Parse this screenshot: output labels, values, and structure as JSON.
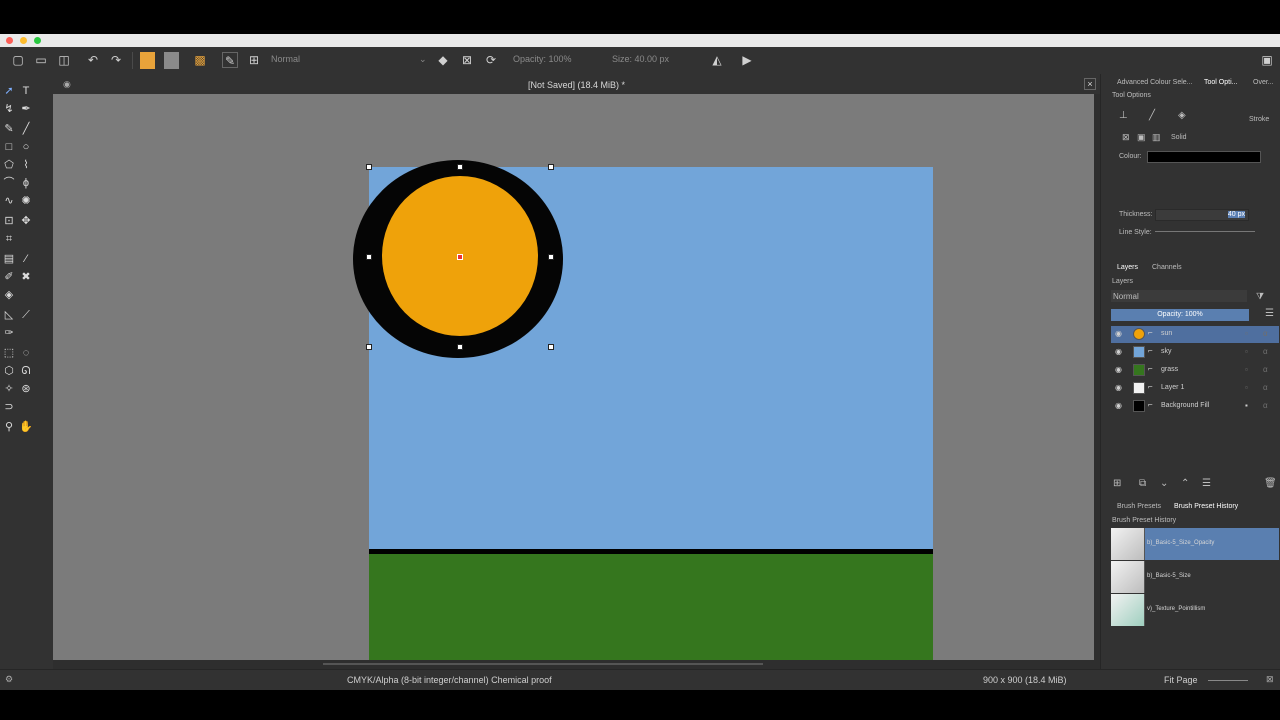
{
  "toolbar": {
    "blend_mode": "Normal",
    "opacity": "Opacity: 100%",
    "size": "Size: 40.00 px",
    "colors": {
      "foreground": "#e8a33a",
      "background": "#8a8a8a"
    }
  },
  "document": {
    "tab_title": "[Not Saved]  (18.4 MiB) *",
    "colors": {
      "sky": "#72a5d9",
      "grass": "#35761e",
      "sun_fill": "#efa20a",
      "sun_outline": "#050505",
      "horizon_line": "#000000"
    }
  },
  "right_dock": {
    "tabs": [
      "Advanced Colour Sele...",
      "Tool Opti...",
      "Over..."
    ],
    "tool_options": {
      "title": "Tool Options",
      "stroke_label": "Stroke",
      "solid_label": "Solid",
      "colour_label": "Colour:",
      "colour_value": "#000000",
      "thickness_label": "Thickness:",
      "thickness_value": "40 px",
      "line_style_label": "Line Style:"
    },
    "layers_panel": {
      "tabs": [
        "Layers",
        "Channels"
      ],
      "title": "Layers",
      "blend_mode": "Normal",
      "opacity": "Opacity:  100%",
      "layers": [
        {
          "name": "sun",
          "thumb": "#efa20a",
          "selected": true
        },
        {
          "name": "sky",
          "thumb": "#72a5d9",
          "selected": false
        },
        {
          "name": "grass",
          "thumb": "#35761e",
          "selected": false
        },
        {
          "name": "Layer 1",
          "thumb": "#f2f2f2",
          "selected": false
        },
        {
          "name": "Background Fill",
          "thumb": "#000000",
          "selected": false
        }
      ]
    },
    "brush_presets": {
      "tabs": [
        "Brush Presets",
        "Brush Preset History"
      ],
      "title": "Brush Preset History",
      "items": [
        {
          "name": "b)_Basic-5_Size_Opacity",
          "selected": true
        },
        {
          "name": "b)_Basic-5_Size",
          "selected": false
        },
        {
          "name": "v)_Texture_Pointillism",
          "selected": false
        }
      ]
    }
  },
  "status_bar": {
    "color_space": "CMYK/Alpha (8-bit integer/channel)  Chemical proof",
    "image_size": "900 x 900 (18.4 MiB)",
    "zoom": "Fit Page"
  }
}
